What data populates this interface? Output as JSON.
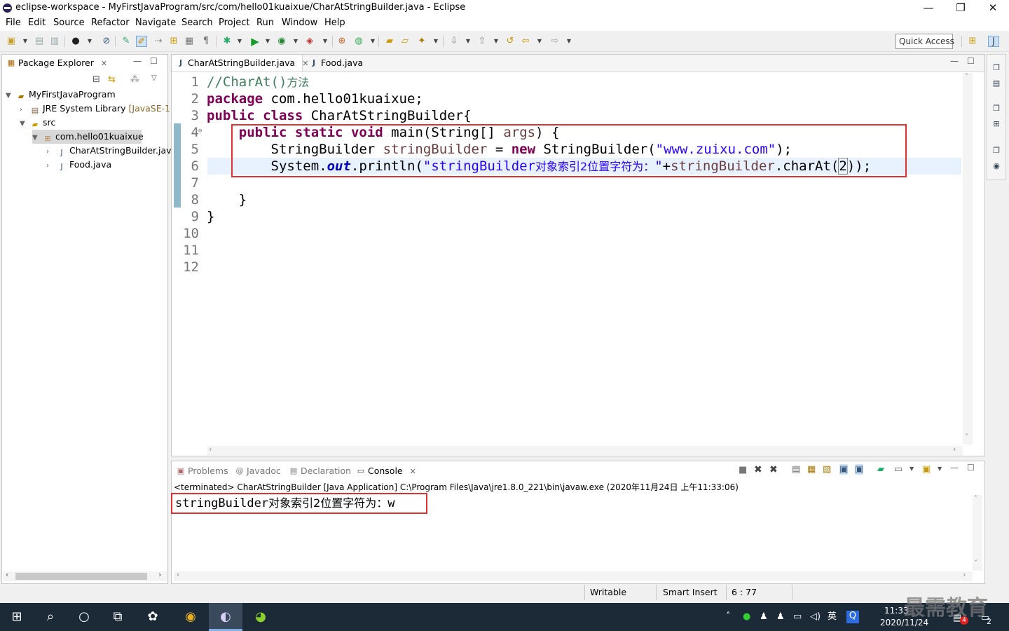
{
  "window": {
    "title": "eclipse-workspace - MyFirstJavaProgram/src/com/hello01kuaixue/CharAtStringBuilder.java - Eclipse",
    "minimize": "—",
    "restore": "❐",
    "close": "✕"
  },
  "menu": [
    "File",
    "Edit",
    "Source",
    "Refactor",
    "Navigate",
    "Search",
    "Project",
    "Run",
    "Window",
    "Help"
  ],
  "toolbar": {
    "quick_access": "Quick Access"
  },
  "package_explorer": {
    "tab_label": "Package Explorer",
    "tree": [
      {
        "label": "MyFirstJavaProgram",
        "level": 0,
        "expanded": true
      },
      {
        "label": "JRE System Library",
        "suffix": "[JavaSE-1.",
        "level": 1,
        "expanded": false
      },
      {
        "label": "src",
        "level": 1,
        "expanded": true
      },
      {
        "label": "com.hello01kuaixue",
        "level": 2,
        "expanded": true,
        "selected": true
      },
      {
        "label": "CharAtStringBuilder.jav",
        "level": 3,
        "expanded": false
      },
      {
        "label": "Food.java",
        "level": 3,
        "expanded": false
      }
    ]
  },
  "editor": {
    "tabs": [
      {
        "label": "CharAtStringBuilder.java",
        "active": true
      },
      {
        "label": "Food.java",
        "active": false
      }
    ],
    "line_numbers": [
      "1",
      "2",
      "3",
      "4",
      "5",
      "6",
      "7",
      "8",
      "9",
      "10",
      "11",
      "12"
    ],
    "code": {
      "l1_comment": "//CharAt()",
      "l1_cjk": "方法",
      "l2_kw": "package",
      "l2_rest": " com.hello01kuaixue;",
      "l3_kw1": "public",
      "l3_kw2": "class",
      "l3_rest": " CharAtStringBuilder{",
      "l4_kw1": "public",
      "l4_kw2": "static",
      "l4_kw3": "void",
      "l4_mid": " main(String[] ",
      "l4_var": "args",
      "l4_end": ") {",
      "l5_type": "StringBuilder ",
      "l5_var": "stringBuilder",
      "l5_eq": " = ",
      "l5_kw": "new",
      "l5_ctor": " StringBuilder(",
      "l5_str": "\"www.zuixu.com\"",
      "l5_end": ");",
      "l6_sys": "System.",
      "l6_out": "out",
      "l6_println": ".println(",
      "l6_str1": "\"stringBuilder",
      "l6_cjk": "对象索引2位置字符为：",
      "l6_str2": "\"",
      "l6_plus": "+",
      "l6_var": "stringBuilder",
      "l6_call": ".charAt(",
      "l6_arg": "2",
      "l6_end": "));",
      "l8": "}",
      "l9": "}"
    }
  },
  "console": {
    "tabs": [
      {
        "label": "Problems",
        "active": false
      },
      {
        "label": "Javadoc",
        "active": false
      },
      {
        "label": "Declaration",
        "active": false
      },
      {
        "label": "Console",
        "active": true
      }
    ],
    "terminated": "<terminated> CharAtStringBuilder [Java Application] C:\\Program Files\\Java\\jre1.8.0_221\\bin\\javaw.exe (2020年11月24日 上午11:33:06)",
    "output_ascii": "stringBuilder",
    "output_cjk": "对象索引2位置字符为：",
    "output_value": "w"
  },
  "status": {
    "writable": "Writable",
    "insert_mode": "Smart Insert",
    "position": "6 : 77"
  },
  "taskbar": {
    "time": "11:33",
    "date": "2020/11/24",
    "ime": "英",
    "watermark": "最需教育",
    "badge1": "4",
    "badge2": "2"
  }
}
